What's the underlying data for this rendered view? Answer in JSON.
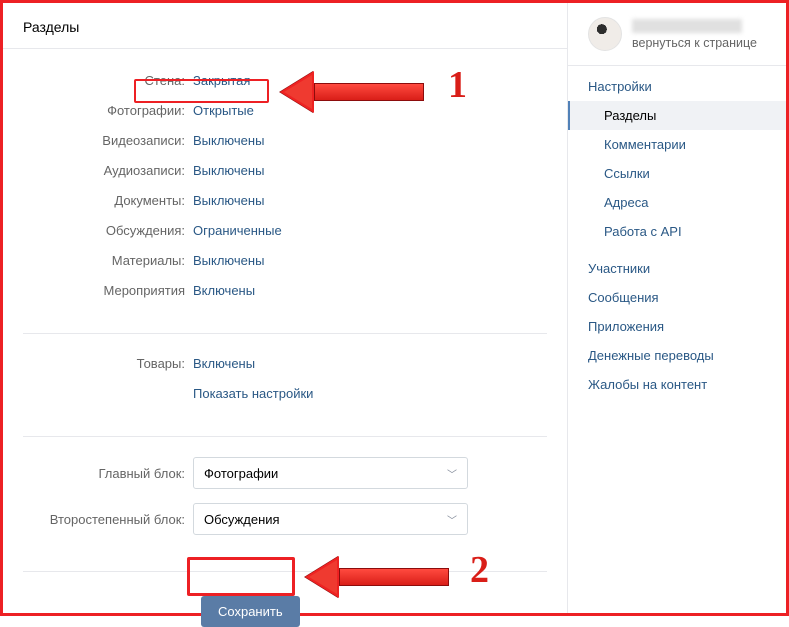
{
  "header": {
    "title": "Разделы"
  },
  "sections": {
    "wall": {
      "label": "Стена:",
      "value": "Закрытая"
    },
    "photos": {
      "label": "Фотографии:",
      "value": "Открытые"
    },
    "videos": {
      "label": "Видеозаписи:",
      "value": "Выключены"
    },
    "audio": {
      "label": "Аудиозаписи:",
      "value": "Выключены"
    },
    "docs": {
      "label": "Документы:",
      "value": "Выключены"
    },
    "discussions": {
      "label": "Обсуждения:",
      "value": "Ограниченные"
    },
    "materials": {
      "label": "Материалы:",
      "value": "Выключены"
    },
    "events": {
      "label": "Мероприятия",
      "value": "Включены"
    }
  },
  "goods": {
    "label": "Товары:",
    "value": "Включены",
    "settings_link": "Показать настройки"
  },
  "blocks": {
    "main": {
      "label": "Главный блок:",
      "value": "Фотографии"
    },
    "secondary": {
      "label": "Второстепенный блок:",
      "value": "Обсуждения"
    }
  },
  "actions": {
    "save": "Сохранить"
  },
  "sidebar": {
    "back_link": "вернуться к странице",
    "nav": {
      "settings": "Настройки",
      "sections": "Разделы",
      "comments": "Комментарии",
      "links": "Ссылки",
      "addresses": "Адреса",
      "api": "Работа с API",
      "members": "Участники",
      "messages": "Сообщения",
      "apps": "Приложения",
      "money": "Денежные переводы",
      "complaints": "Жалобы на контент"
    }
  },
  "annotations": {
    "one": "1",
    "two": "2"
  }
}
